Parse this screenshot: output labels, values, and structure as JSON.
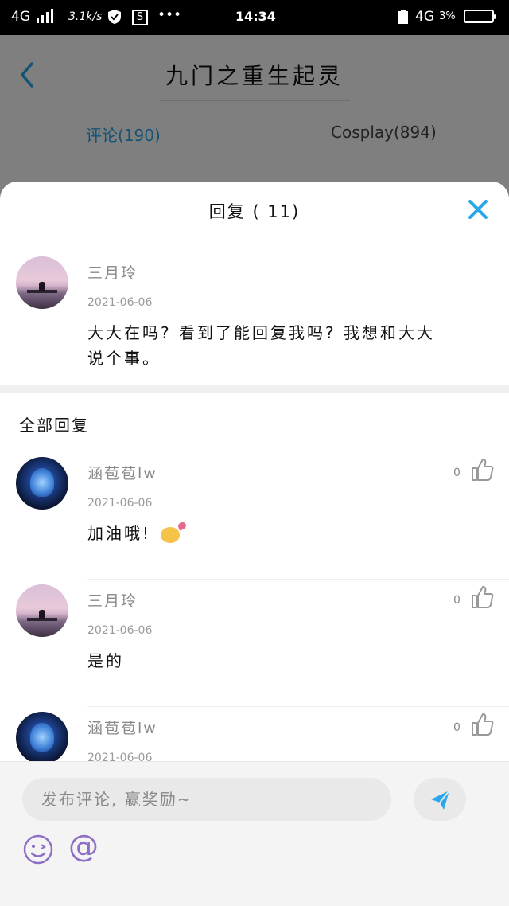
{
  "status_bar": {
    "network_left": "4G",
    "speed": "3.1k/s",
    "sim_icon_label": "S",
    "more": "•••",
    "time": "14:34",
    "network_right": "4G",
    "battery_text": "3%"
  },
  "header": {
    "title": "九门之重生起灵"
  },
  "tabs": [
    {
      "label": "评论(190)",
      "active": true
    },
    {
      "label": "Cosplay(894)",
      "active": false
    }
  ],
  "sheet": {
    "title": "回复 ( 11)",
    "original": {
      "user": "三月玲",
      "date": "2021-06-06",
      "text_line1": "大大在吗? 看到了能回复我吗? 我想和大大",
      "text_line2": "说个事。"
    },
    "section_title": "全部回复",
    "replies": [
      {
        "user": "涵苞苞lw",
        "date": "2021-06-06",
        "text": "加油哦!",
        "likes": "0",
        "avatar": "night"
      },
      {
        "user": "三月玲",
        "date": "2021-06-06",
        "text": "是的",
        "likes": "0",
        "avatar": "sunset"
      },
      {
        "user": "涵苞苞lw",
        "date": "2021-06-06",
        "text": "",
        "likes": "0",
        "avatar": "night"
      }
    ]
  },
  "input": {
    "placeholder": "发布评论, 赢奖励~",
    "mention_symbol": "@"
  },
  "colors": {
    "accent": "#2aa7ea",
    "mention": "#8e6fc6"
  }
}
